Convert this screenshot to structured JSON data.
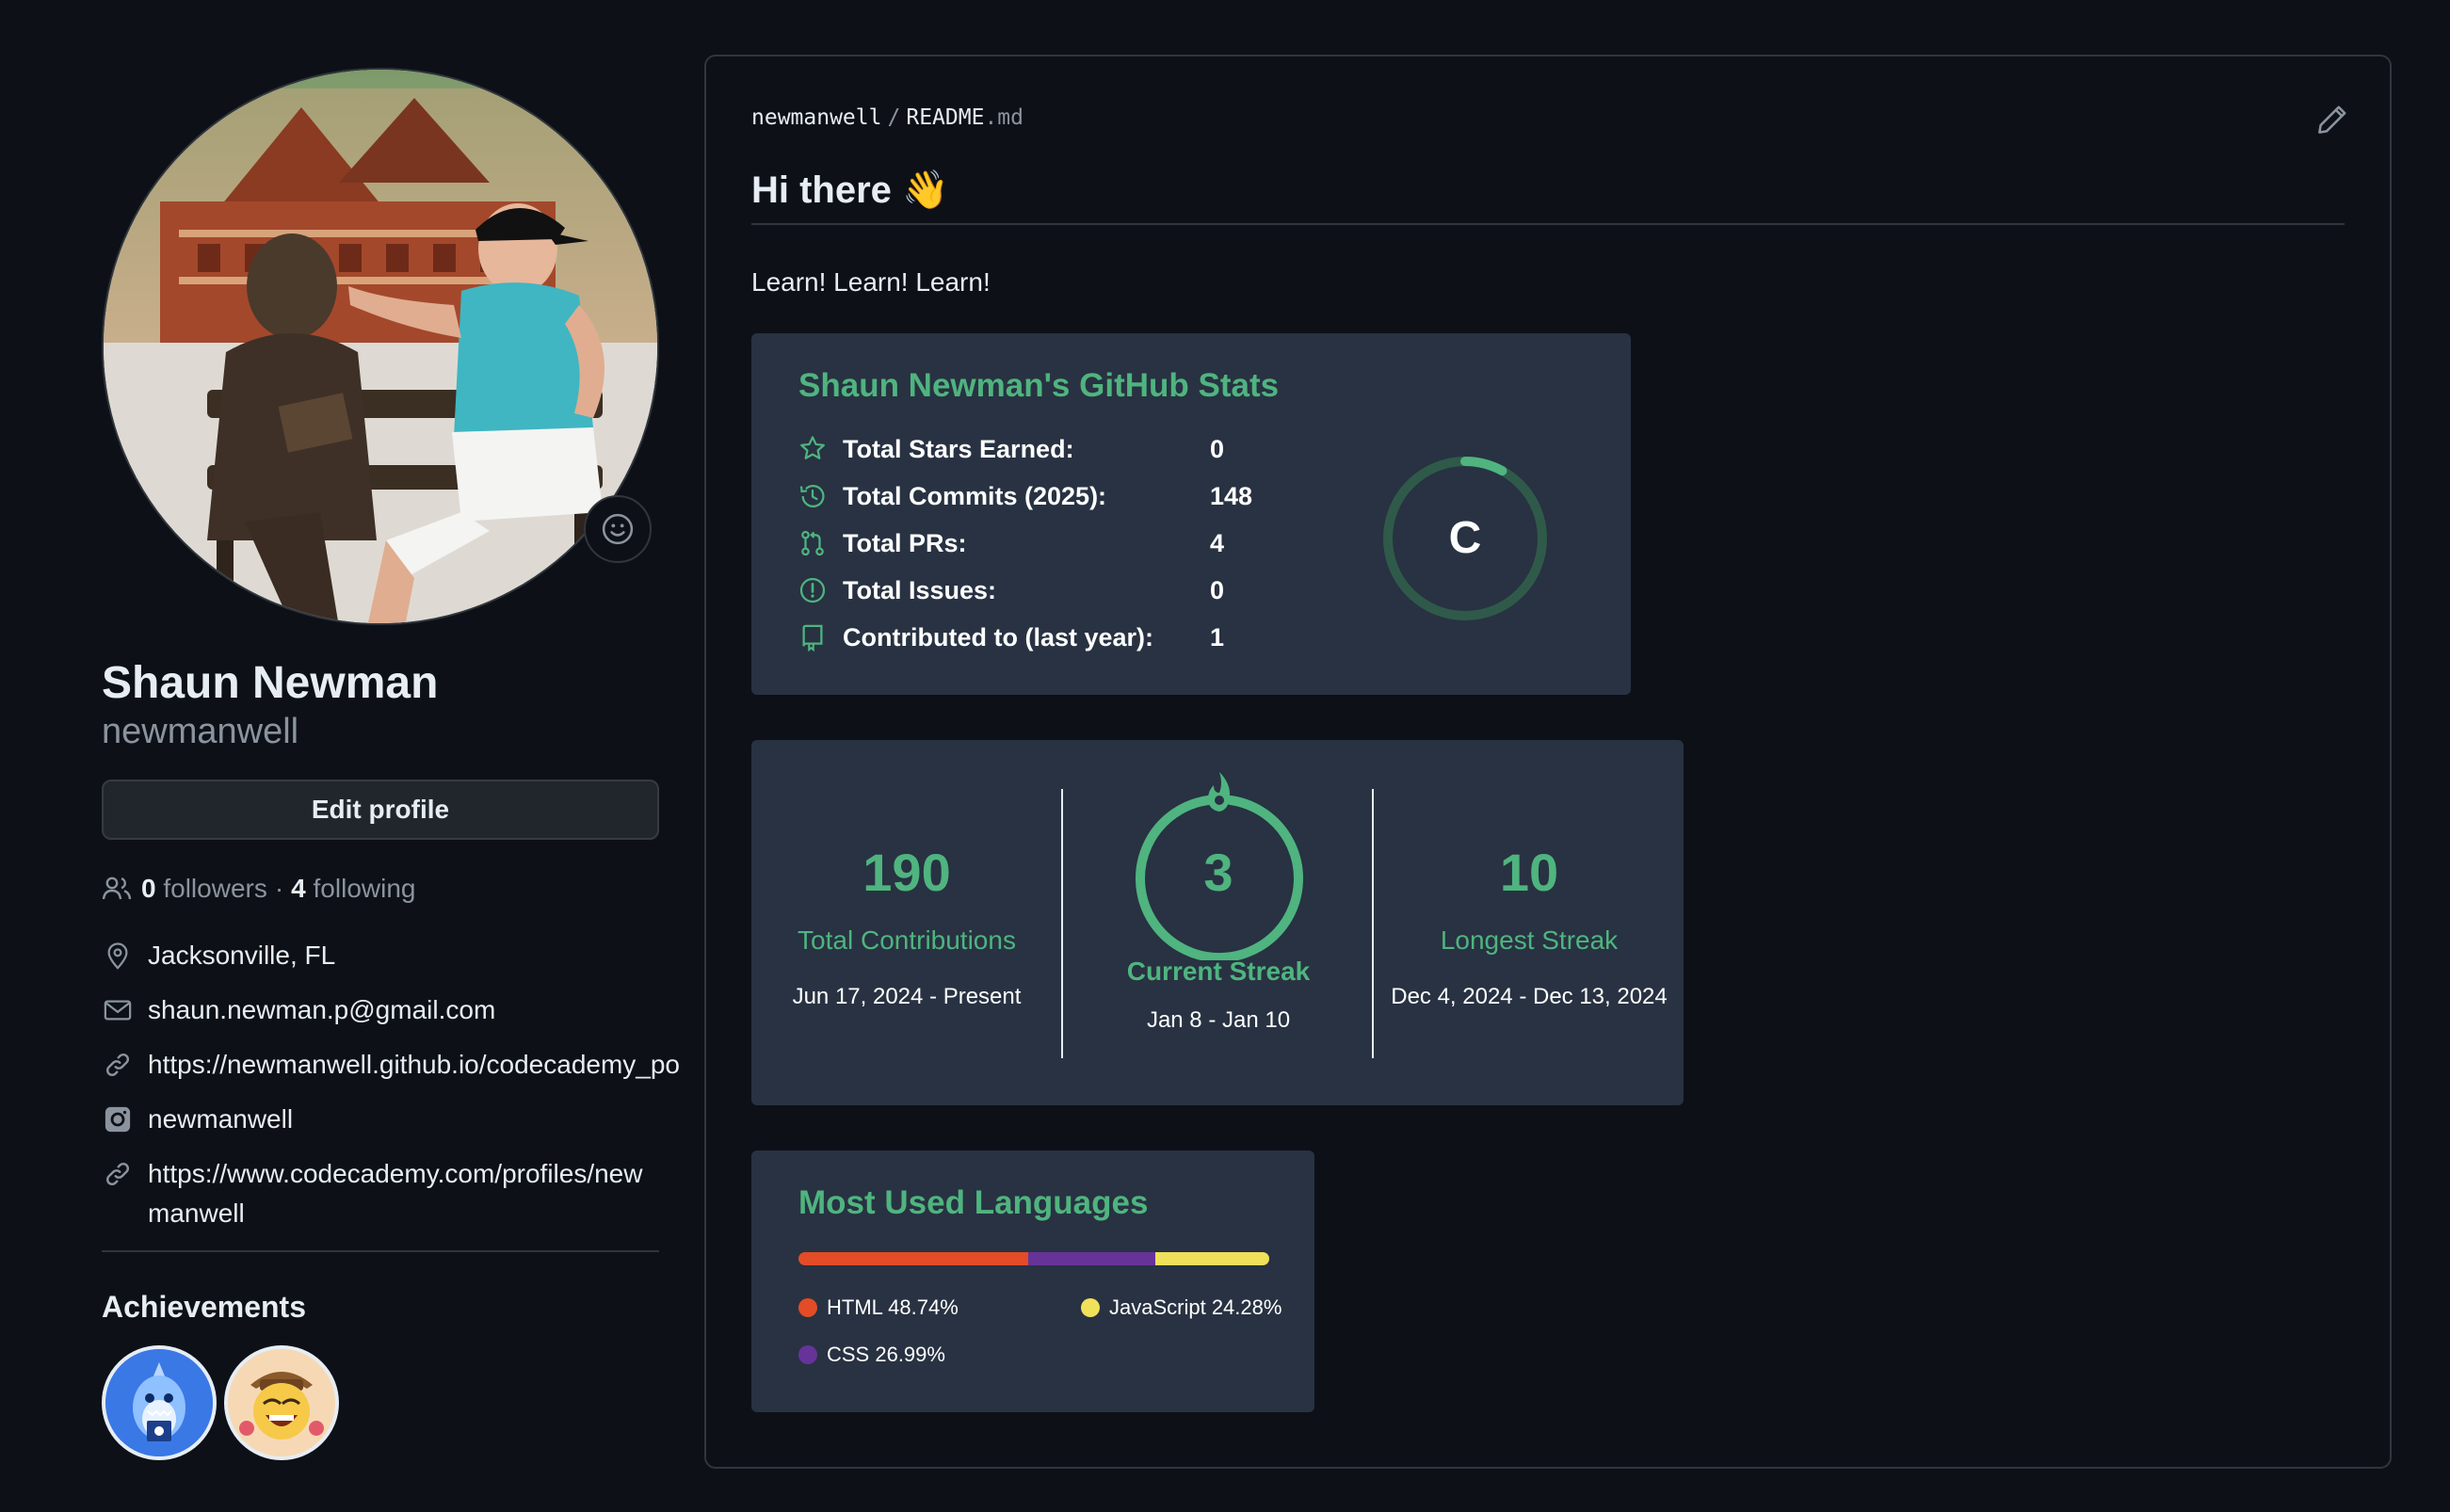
{
  "profile": {
    "full_name": "Shaun Newman",
    "login": "newmanwell",
    "edit_button": "Edit profile",
    "followers_count": "0",
    "followers_label": "followers",
    "separator": "·",
    "following_count": "4",
    "following_label": "following",
    "details": [
      {
        "icon": "location-icon",
        "text": "Jacksonville, FL"
      },
      {
        "icon": "mail-icon",
        "text": "shaun.newman.p@gmail.com"
      },
      {
        "icon": "link-icon",
        "text": "https://newmanwell.github.io/codecademy_po"
      },
      {
        "icon": "instagram-icon",
        "text": "newmanwell"
      },
      {
        "icon": "link-icon",
        "text": "https://www.codecademy.com/profiles/newmanwell"
      }
    ],
    "achievements_title": "Achievements",
    "achievements": [
      "pull-shark-badge",
      "yolo-badge"
    ]
  },
  "readme": {
    "owner": "newmanwell",
    "slash": "/",
    "file_name": "README",
    "file_ext": ".md",
    "heading": "Hi there 👋",
    "lead": "Learn! Learn! Learn!"
  },
  "stats_card": {
    "title": "Shaun Newman's GitHub Stats",
    "rows": [
      {
        "icon": "star-icon",
        "label": "Total Stars Earned:",
        "value": "0"
      },
      {
        "icon": "history-icon",
        "label": "Total Commits (2025):",
        "value": "148"
      },
      {
        "icon": "pull-request-icon",
        "label": "Total PRs:",
        "value": "4"
      },
      {
        "icon": "issue-icon",
        "label": "Total Issues:",
        "value": "0"
      },
      {
        "icon": "repo-icon",
        "label": "Contributed to (last year):",
        "value": "1"
      }
    ],
    "rank": "C",
    "rank_progress": 0.08,
    "accent": "#4fb47f"
  },
  "streak_card": {
    "total_contributions": "190",
    "total_label": "Total Contributions",
    "total_range": "Jun 17, 2024 - Present",
    "current_streak": "3",
    "current_label": "Current Streak",
    "current_range": "Jan 8 - Jan 10",
    "longest_streak": "10",
    "longest_label": "Longest Streak",
    "longest_range": "Dec 4, 2024 - Dec 13, 2024"
  },
  "languages_card": {
    "title": "Most Used Languages",
    "languages": [
      {
        "name": "HTML",
        "percent": 48.74,
        "label": "HTML 48.74%",
        "color": "#e34c26"
      },
      {
        "name": "CSS",
        "percent": 26.99,
        "label": "CSS 26.99%",
        "color": "#663399"
      },
      {
        "name": "JavaScript",
        "percent": 24.28,
        "label": "JavaScript 24.28%",
        "color": "#f1e05a"
      }
    ]
  },
  "colors": {
    "background": "#0d1117",
    "card": "#283242",
    "accent_green": "#4fb47f",
    "muted": "#8b949e",
    "border": "#30363d"
  }
}
